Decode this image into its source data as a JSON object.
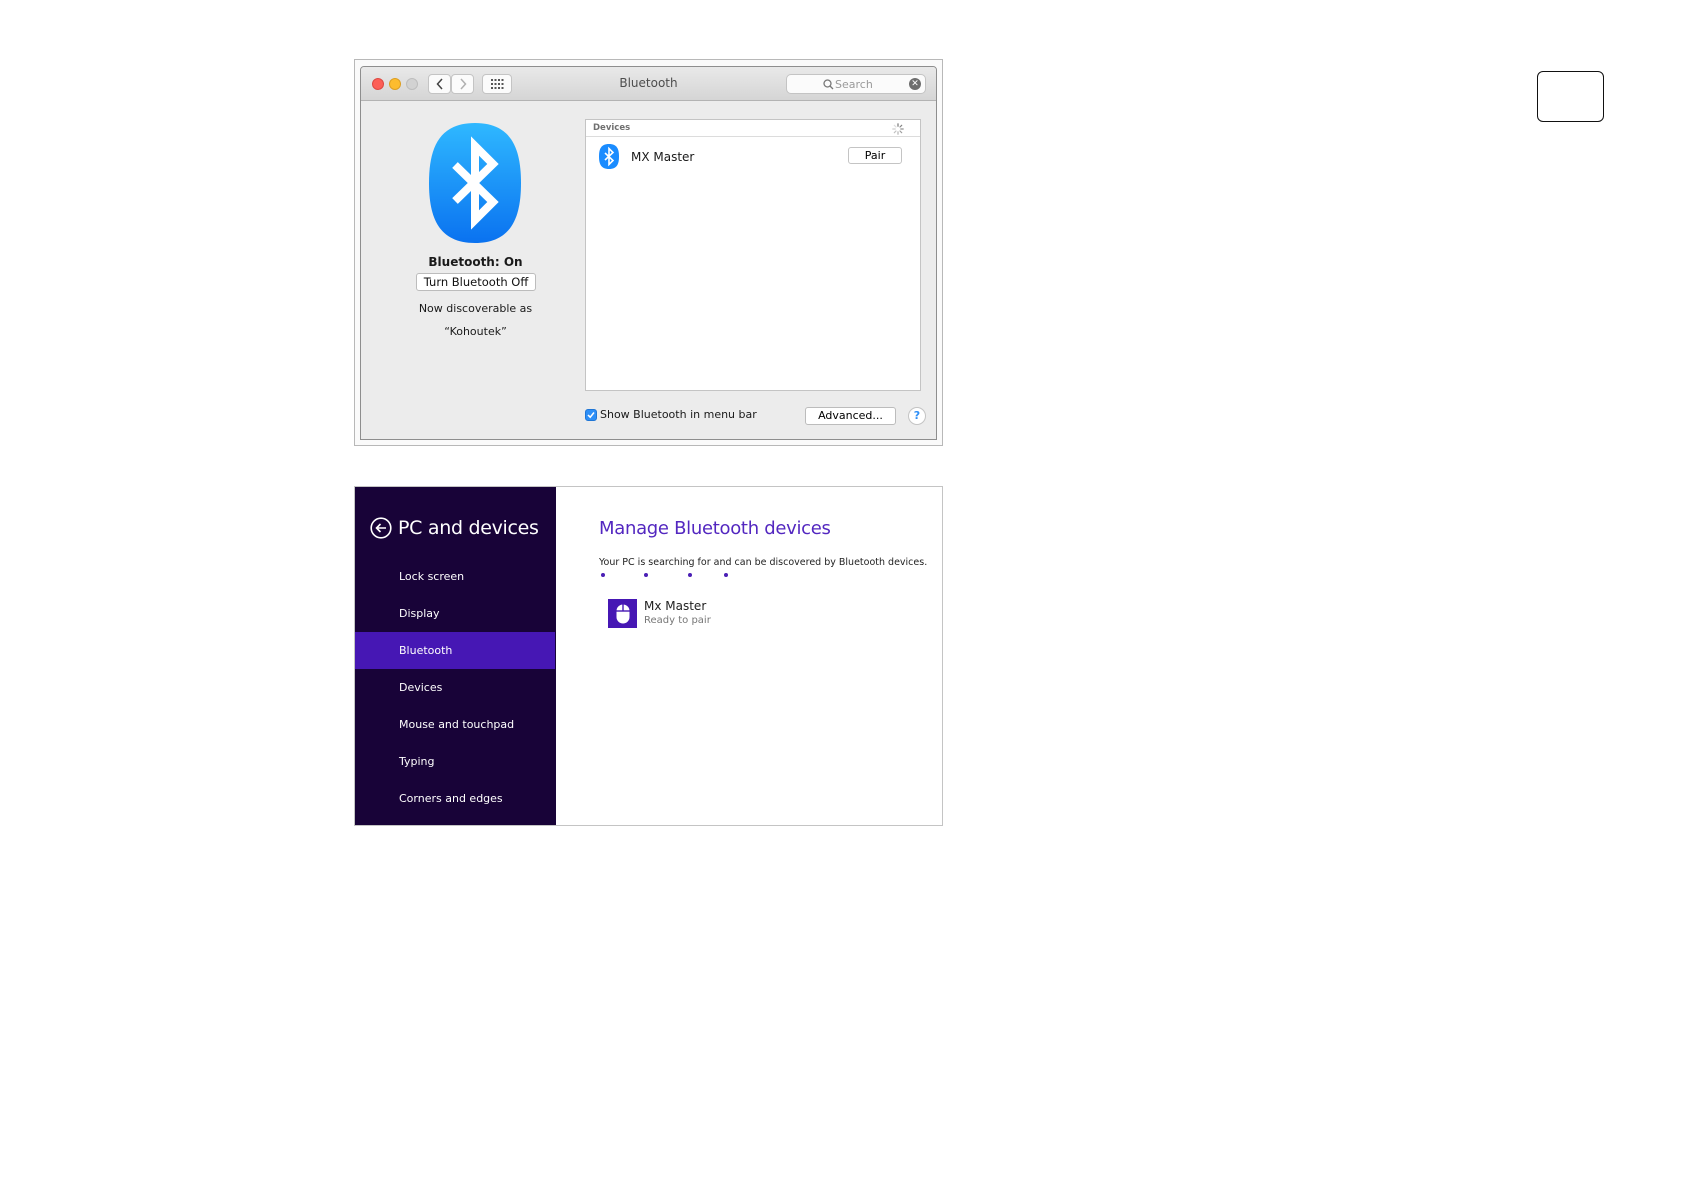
{
  "mac": {
    "window_title": "Bluetooth",
    "search_placeholder": "Search",
    "status": "Bluetooth: On",
    "toggle_label": "Turn Bluetooth Off",
    "discoverable_line1": "Now discoverable as",
    "discoverable_line2": "“Kohoutek”",
    "devices_header": "Devices",
    "devices": [
      {
        "name": "MX Master",
        "action": "Pair"
      }
    ],
    "show_in_menubar_label": "Show Bluetooth in menu bar",
    "show_in_menubar_checked": true,
    "advanced_label": "Advanced...",
    "help_label": "?",
    "colors": {
      "bluetooth_blue": "#1a8cff",
      "checkbox_blue": "#2e8ff7"
    }
  },
  "win": {
    "heading": "PC and devices",
    "nav_items": [
      {
        "label": "Lock screen",
        "active": false
      },
      {
        "label": "Display",
        "active": false
      },
      {
        "label": "Bluetooth",
        "active": true
      },
      {
        "label": "Devices",
        "active": false
      },
      {
        "label": "Mouse and touchpad",
        "active": false
      },
      {
        "label": "Typing",
        "active": false
      },
      {
        "label": "Corners and edges",
        "active": false
      }
    ],
    "title": "Manage Bluetooth devices",
    "description": "Your PC is searching for and can be discovered by Bluetooth devices.",
    "device": {
      "name": "Mx Master",
      "status": "Ready to pair"
    },
    "colors": {
      "sidebar_bg": "#180338",
      "accent": "#4617b4",
      "title": "#5327c0"
    }
  }
}
